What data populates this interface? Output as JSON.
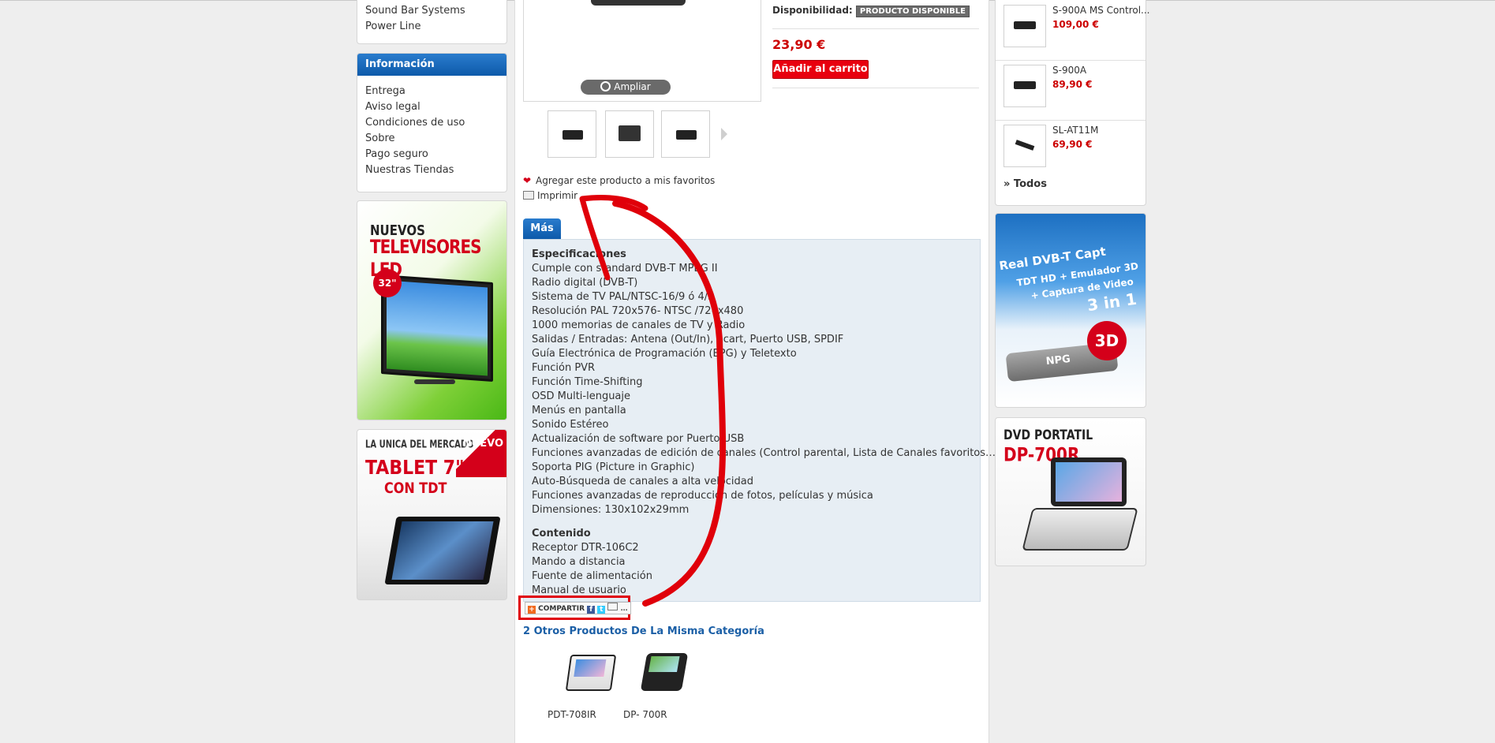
{
  "left_col": {
    "categories": [
      "Sound Bar Systems",
      "Power Line"
    ],
    "info_title": "Información",
    "info_links": [
      "Entrega",
      "Aviso legal",
      "Condiciones de uso",
      "Sobre",
      "Pago seguro",
      "Nuestras Tiendas"
    ],
    "banner_led": {
      "line1": "NUEVOS",
      "line2": "TELEVISORES LED",
      "size": "32\""
    },
    "banner_tablet": {
      "line1": "LA UNICA DEL MERCADO",
      "line2": "TABLET 7\"",
      "line3": "CON TDT",
      "ribbon": "NUEVO"
    }
  },
  "product": {
    "zoom_label": "Ampliar",
    "availability_label": "Disponibilidad:",
    "availability_value": "PRODUCTO DISPONIBLE",
    "price": "23,90 €",
    "add_to_cart": "Añadir al carrito",
    "favorites": "Agregar este producto a mis favoritos",
    "print": "Imprimir",
    "tab": "Más",
    "spec_heading": "Especificaciones",
    "specs": [
      "Cumple con standard DVB-T MPEG II",
      "Radio digital (DVB-T)",
      "Sistema de TV PAL/NTSC-16/9 ó 4/3",
      "Resolución PAL 720x576- NTSC /720x480",
      "1000 memorias de canales de TV y Radio",
      "Salidas / Entradas: Antena (Out/In), Scart, Puerto USB, SPDIF",
      "Guía Electrónica de Programación (EPG) y Teletexto",
      "Función PVR",
      "Función Time-Shifting",
      "OSD Multi-lenguaje",
      "Menús en pantalla",
      "Sonido Estéreo",
      "Actualización de software por Puerto USB",
      "Funciones avanzadas de edición de canales (Control parental, Lista de Canales favoritos…)",
      "Soporta PIG (Picture in Graphic)",
      "Auto-Búsqueda de canales a alta velocidad",
      "Funciones avanzadas de reproducción de fotos, películas y música",
      "Dimensiones: 130x102x29mm"
    ],
    "content_heading": "Contenido",
    "contents": [
      "Receptor DTR-106C2",
      "Mando a distancia",
      "Fuente de alimentación",
      "Manual de usuario"
    ],
    "share_label": "COMPARTIR",
    "related_title": "2 Otros Productos De La Misma Categoría",
    "related": [
      "PDT-708IR",
      "DP- 700R"
    ]
  },
  "right_col": {
    "products": [
      {
        "name": "S-900A MS Control...",
        "price": "109,00 €"
      },
      {
        "name": "S-900A",
        "price": "89,90 €"
      },
      {
        "name": "SL-AT11M",
        "price": "69,90 €"
      }
    ],
    "all_link": "» Todos",
    "banner_3d": {
      "line1": "Real DVB-T Capt",
      "line2": "TDT HD + Emulador 3D",
      "line3": "+ Captura de Video",
      "line4": "3 in 1",
      "brand": "NPG",
      "badge": "3D"
    },
    "banner_dvd": {
      "line1": "DVD PORTATIL",
      "line2": "DP-700R"
    }
  },
  "colors": {
    "accent_blue": "#0d5aaa",
    "price_red": "#cc0000",
    "button_red": "#e8000f",
    "annotation_red": "#e0000a"
  }
}
